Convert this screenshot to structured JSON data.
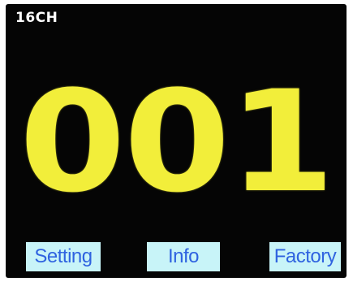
{
  "display": {
    "channel_label": "16CH",
    "channel_number": "001"
  },
  "buttons": {
    "setting_label": "Setting",
    "info_label": "Info",
    "factory_label": "Factory"
  },
  "colors": {
    "screen_background": "#050505",
    "channel_number": "#f2ee3a",
    "button_background": "#c8f4f8",
    "button_text": "#2f63e0"
  }
}
